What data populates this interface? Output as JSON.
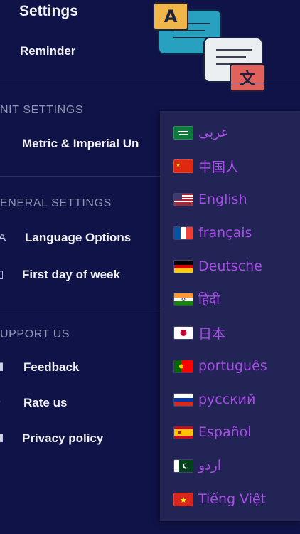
{
  "header": {
    "title": "Settings"
  },
  "reminder": {
    "label": "Reminder"
  },
  "unit_settings": {
    "heading": "NIT SETTINGS",
    "item_label": "Metric & Imperial Un"
  },
  "general_settings": {
    "heading": "ENERAL SETTINGS",
    "language_label": "Language Options",
    "first_day_label": "First day of week"
  },
  "support": {
    "heading": "UPPORT US",
    "feedback_label": "Feedback",
    "rate_label": "Rate us",
    "privacy_label": "Privacy policy"
  },
  "illustration": {
    "badge_a": "A",
    "badge_zh": "文"
  },
  "language_menu": {
    "items": [
      {
        "label": "عربى",
        "flag": "saudi-arabia"
      },
      {
        "label": "中国人",
        "flag": "china"
      },
      {
        "label": "English",
        "flag": "usa"
      },
      {
        "label": "français",
        "flag": "france"
      },
      {
        "label": "Deutsche",
        "flag": "germany"
      },
      {
        "label": "हिंदी",
        "flag": "india"
      },
      {
        "label": "日本",
        "flag": "japan"
      },
      {
        "label": "português",
        "flag": "portugal"
      },
      {
        "label": "русский",
        "flag": "russia"
      },
      {
        "label": "Español",
        "flag": "spain"
      },
      {
        "label": "اردو",
        "flag": "pakistan"
      },
      {
        "label": "Tiếng Việt",
        "flag": "vietnam"
      }
    ]
  },
  "colors": {
    "background": "#101347",
    "dropdown": "#222455",
    "language_text": "#a84de8",
    "section_heading": "#9296b4"
  }
}
